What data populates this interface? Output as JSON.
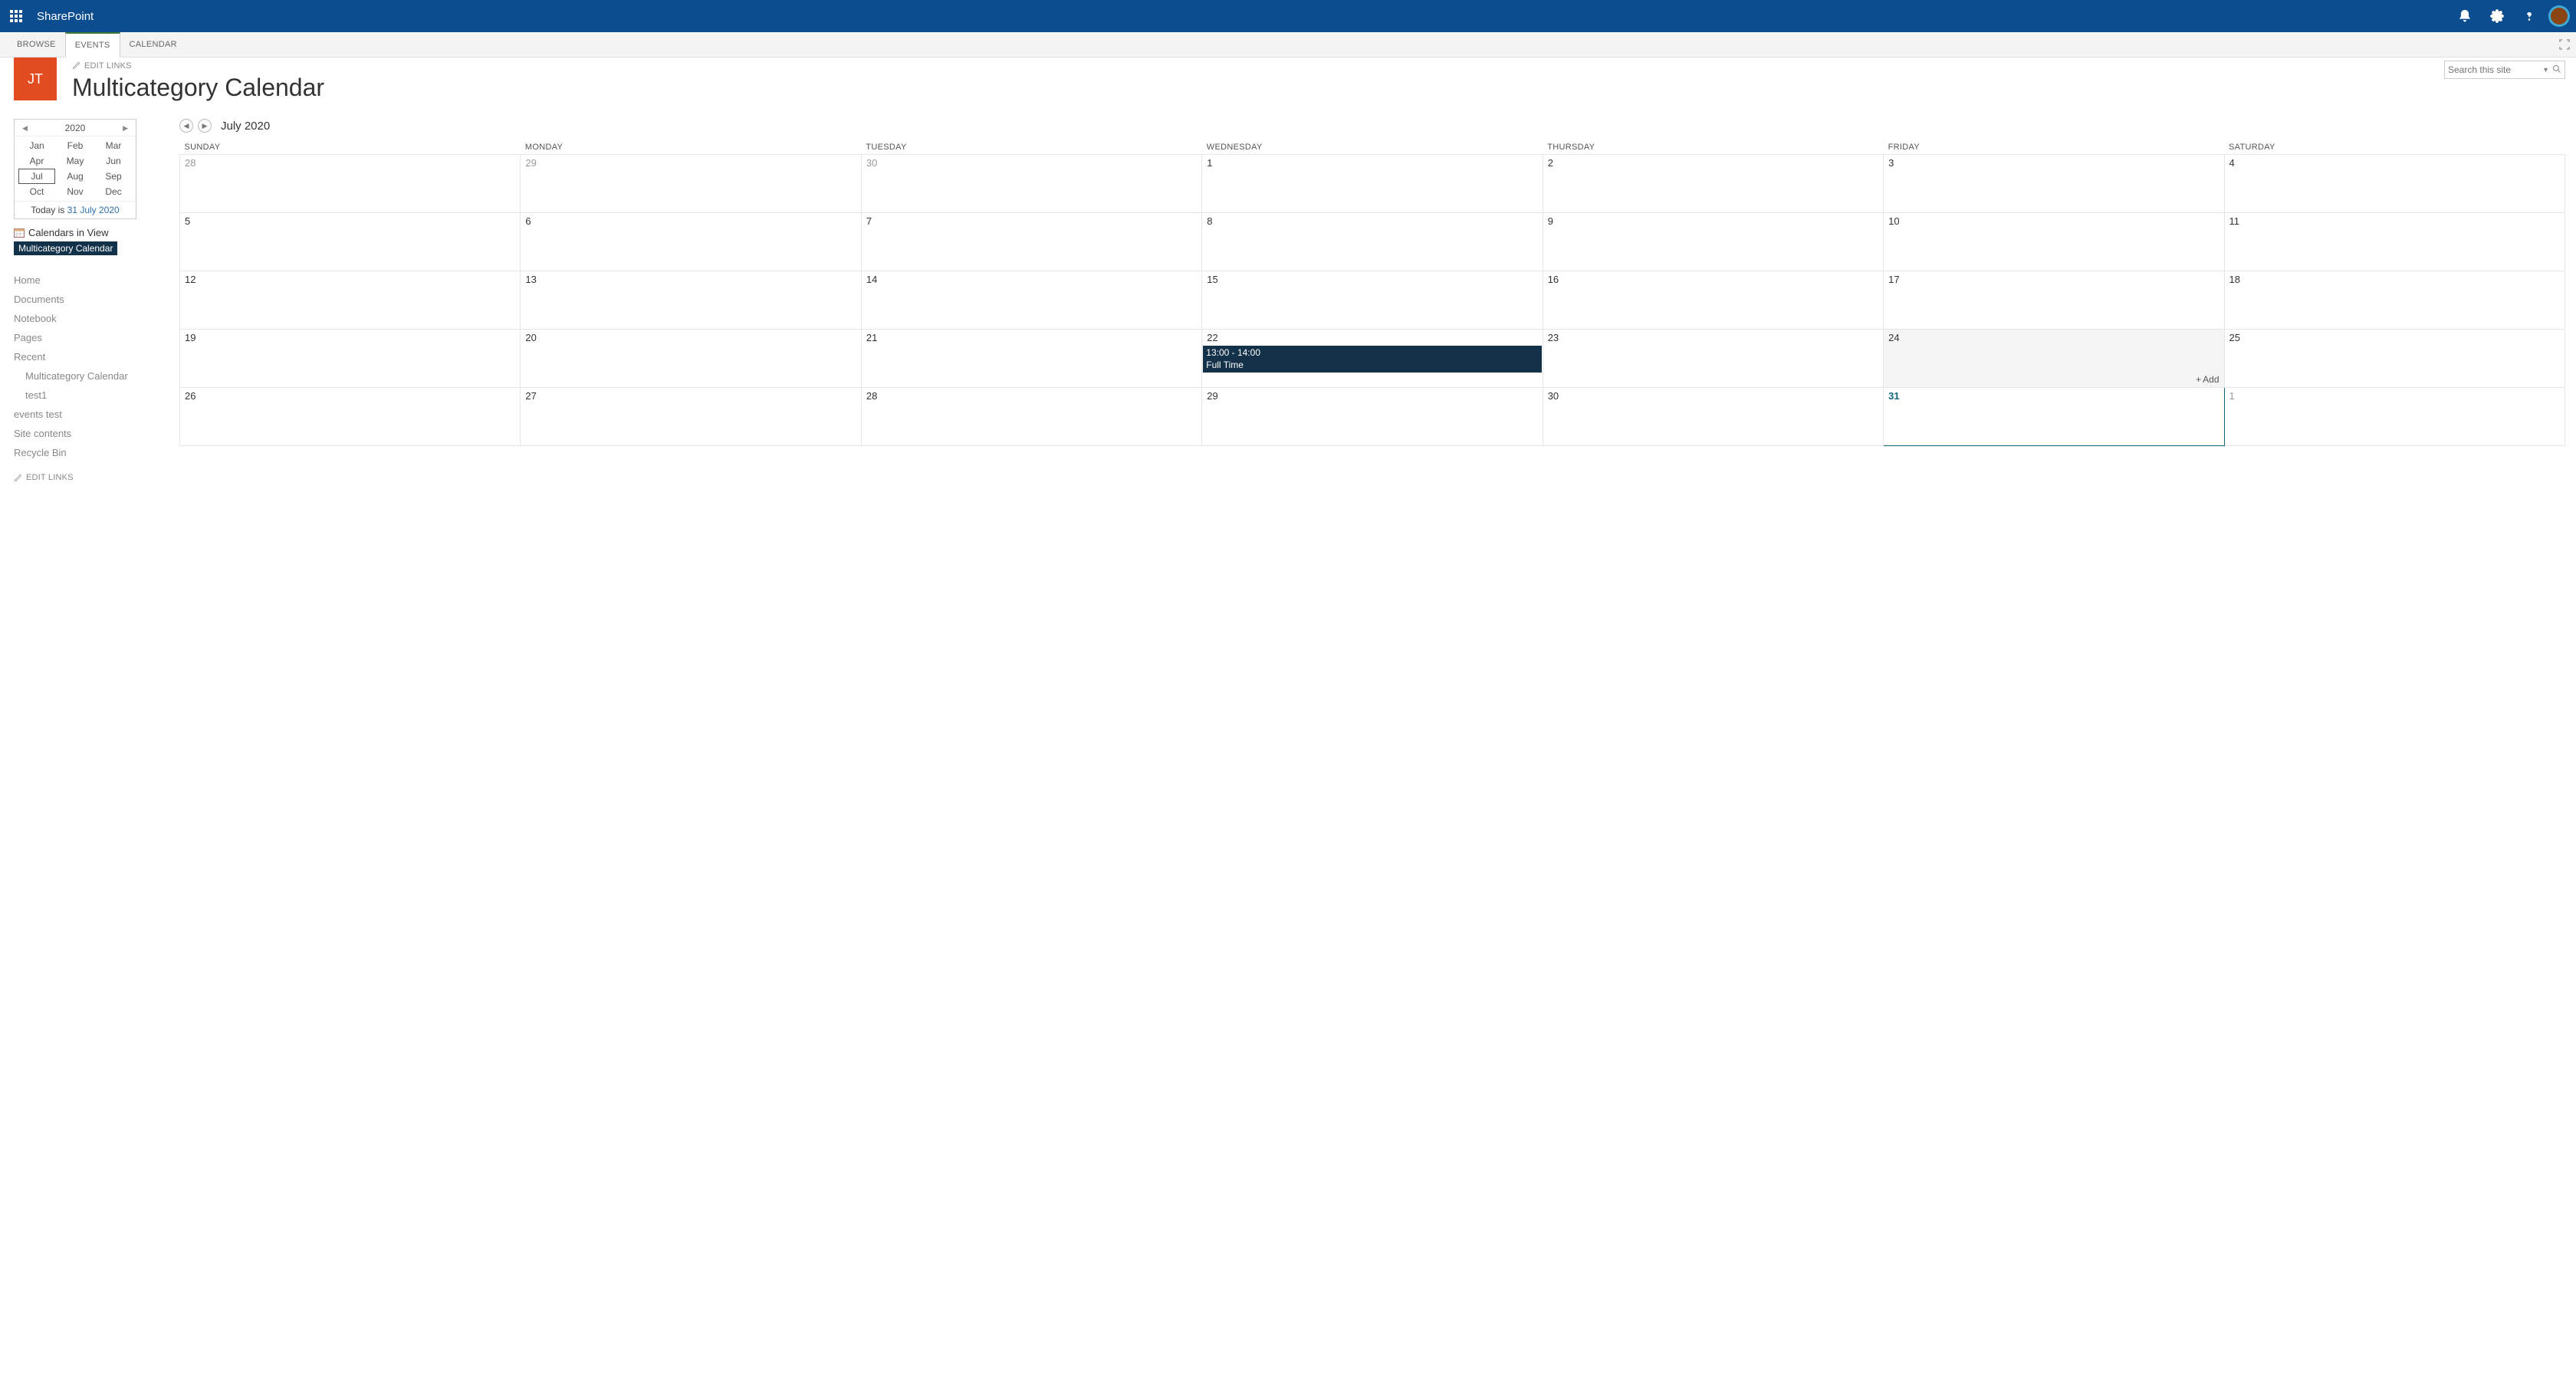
{
  "suite": {
    "title": "SharePoint"
  },
  "ribbon": {
    "tabs": [
      "BROWSE",
      "EVENTS",
      "CALENDAR"
    ],
    "active": 1
  },
  "siteHeader": {
    "logoText": "JT",
    "editLinks": "EDIT LINKS",
    "pageTitle": "Multicategory Calendar",
    "searchPlaceholder": "Search this site"
  },
  "miniCalendar": {
    "year": "2020",
    "months": [
      [
        "Jan",
        "Feb",
        "Mar"
      ],
      [
        "Apr",
        "May",
        "Jun"
      ],
      [
        "Jul",
        "Aug",
        "Sep"
      ],
      [
        "Oct",
        "Nov",
        "Dec"
      ]
    ],
    "selected": "Jul",
    "todayLabel": "Today is ",
    "todayDate": "31 July 2020"
  },
  "calendarsInView": {
    "header": "Calendars in View",
    "items": [
      "Multicategory Calendar"
    ]
  },
  "quickLaunch": [
    {
      "label": "Home",
      "sub": false
    },
    {
      "label": "Documents",
      "sub": false
    },
    {
      "label": "Notebook",
      "sub": false
    },
    {
      "label": "Pages",
      "sub": false
    },
    {
      "label": "Recent",
      "sub": false
    },
    {
      "label": "Multicategory Calendar",
      "sub": true
    },
    {
      "label": "test1",
      "sub": true
    },
    {
      "label": "events test",
      "sub": false
    },
    {
      "label": "Site contents",
      "sub": false
    },
    {
      "label": "Recycle Bin",
      "sub": false
    }
  ],
  "calendarView": {
    "title": "July 2020",
    "dayHeaders": [
      "SUNDAY",
      "MONDAY",
      "TUESDAY",
      "WEDNESDAY",
      "THURSDAY",
      "FRIDAY",
      "SATURDAY"
    ],
    "addLabel": "Add",
    "weeks": [
      [
        {
          "num": "28",
          "other": true
        },
        {
          "num": "29",
          "other": true
        },
        {
          "num": "30",
          "other": true
        },
        {
          "num": "1"
        },
        {
          "num": "2"
        },
        {
          "num": "3"
        },
        {
          "num": "4"
        }
      ],
      [
        {
          "num": "5"
        },
        {
          "num": "6"
        },
        {
          "num": "7"
        },
        {
          "num": "8"
        },
        {
          "num": "9"
        },
        {
          "num": "10"
        },
        {
          "num": "11"
        }
      ],
      [
        {
          "num": "12"
        },
        {
          "num": "13"
        },
        {
          "num": "14"
        },
        {
          "num": "15"
        },
        {
          "num": "16"
        },
        {
          "num": "17"
        },
        {
          "num": "18"
        }
      ],
      [
        {
          "num": "19"
        },
        {
          "num": "20"
        },
        {
          "num": "21"
        },
        {
          "num": "22",
          "events": [
            {
              "time": "13:00 - 14:00",
              "title": "Full Time"
            }
          ]
        },
        {
          "num": "23"
        },
        {
          "num": "24",
          "hovered": true,
          "showAdd": true
        },
        {
          "num": "25"
        }
      ],
      [
        {
          "num": "26"
        },
        {
          "num": "27"
        },
        {
          "num": "28"
        },
        {
          "num": "29"
        },
        {
          "num": "30"
        },
        {
          "num": "31",
          "today": true
        },
        {
          "num": "1",
          "other": true
        }
      ]
    ]
  },
  "footer": {
    "editLinks": "EDIT LINKS"
  }
}
